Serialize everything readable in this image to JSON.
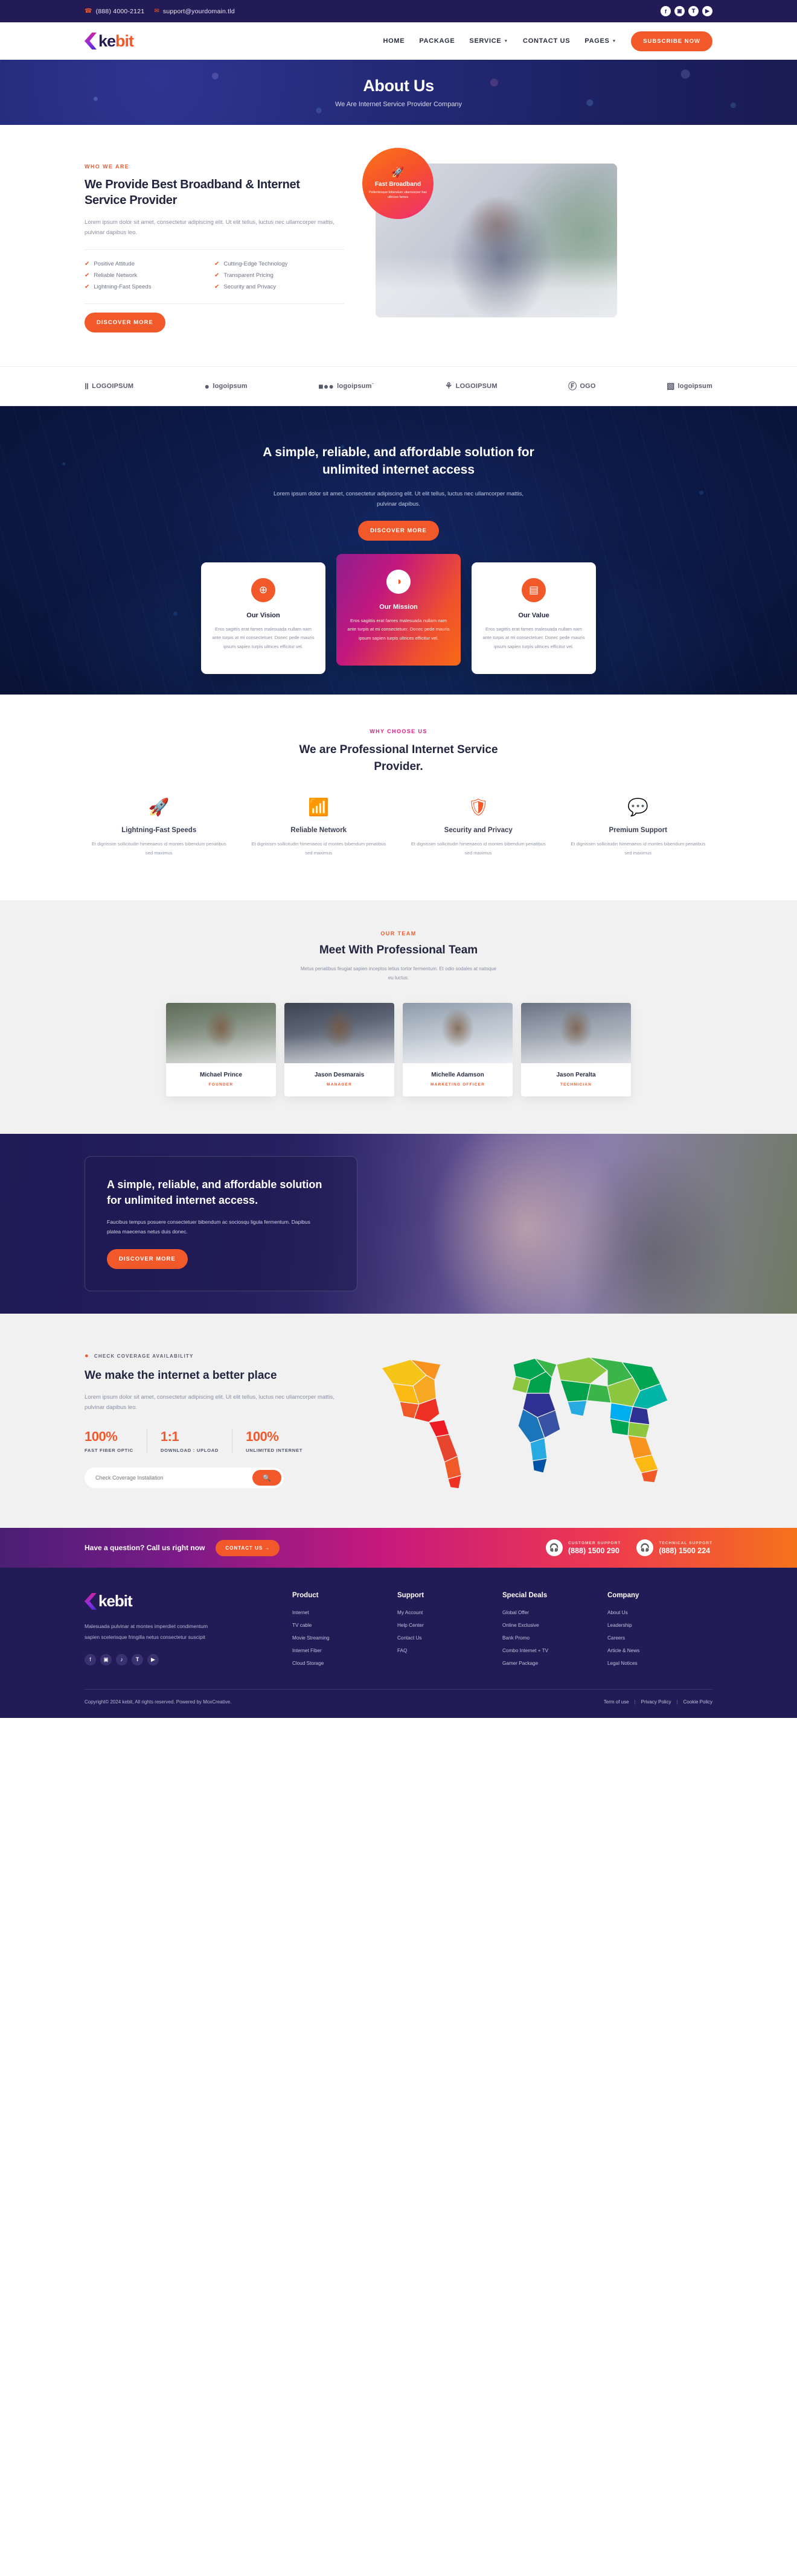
{
  "topbar": {
    "phone": "(888) 4000-2121",
    "email": "support@yourdomain.tld",
    "phone_icon": "phone-icon",
    "email_icon": "envelope-icon",
    "social": [
      {
        "name": "facebook",
        "glyph": "f"
      },
      {
        "name": "instagram",
        "glyph": "▣"
      },
      {
        "name": "twitter",
        "glyph": "𝐓"
      },
      {
        "name": "youtube",
        "glyph": "▶"
      }
    ]
  },
  "nav": {
    "logo_main": "ke",
    "logo_accent": "bit",
    "items": [
      {
        "label": "Home",
        "has_caret": false
      },
      {
        "label": "Package",
        "has_caret": false
      },
      {
        "label": "Service",
        "has_caret": true
      },
      {
        "label": "Contact Us",
        "has_caret": false
      },
      {
        "label": "Pages",
        "has_caret": true
      }
    ],
    "cta": "Subscribe Now"
  },
  "hero": {
    "title": "About Us",
    "subtitle": "We Are Internet Service Provider Company"
  },
  "about": {
    "eyebrow": "WHO WE ARE",
    "title": "We Provide Best Broadband & Internet Service Provider",
    "paragraph": "Lorem ipsum dolor sit amet, consectetur adipiscing elit. Ut elit tellus, luctus nec ullamcorper mattis, pulvinar dapibus leo.",
    "ticks": [
      "Positive Attitude",
      "Cutting-Edge Technology",
      "Reliable Network",
      "Transparent Pricing",
      "Lightning-Fast Speeds",
      "Security and Privacy"
    ],
    "cta": "Discover More",
    "badge": {
      "icon": "rocket-icon",
      "title": "Fast Broadband",
      "text": "Pellentesque bibendum ullamcorper hac ultricies fames"
    }
  },
  "logos": [
    {
      "name": "logoipsum-1",
      "glyph": "‖",
      "text": "LOGOIPSUM"
    },
    {
      "name": "logoipsum-2",
      "glyph": "●",
      "text": "logoipsum"
    },
    {
      "name": "logoipsum-3",
      "glyph": "■●●",
      "text": "logoipsum˙"
    },
    {
      "name": "logoipsum-4",
      "glyph": "⚘",
      "text": "LOGOIPSUM"
    },
    {
      "name": "logoipsum-5",
      "glyph": "Ⓕ",
      "text": "OGO"
    },
    {
      "name": "logoipsum-6",
      "glyph": "▧",
      "text": "logoipsum"
    }
  ],
  "darkcta": {
    "title": "A simple, reliable, and affordable solution for unlimited internet access",
    "paragraph": "Lorem ipsum dolor sit amet, consectetur adipiscing elit. Ut elit tellus, luctus nec ullamcorper mattis, pulvinar dapibus.",
    "cta": "Discover More",
    "cards": [
      {
        "icon": "globe-icon",
        "glyph": "⊕",
        "title": "Our Vision",
        "text": "Eros sagittis erat fames malesuada nullam nam ante turpis at mi consectetuer. Donec pede mauris ipsum sapien turpis ultrices efficitur vel."
      },
      {
        "icon": "wifi-icon",
        "glyph": "◑",
        "title": "Our Mission",
        "text": "Eros sagittis erat fames malesuada nullam nam ante turpis at mi consectetuer. Donec pede mauris ipsum sapien turpis ultrices efficitur vel."
      },
      {
        "icon": "devices-icon",
        "glyph": "▤",
        "title": "Our Value",
        "text": "Eros sagittis erat fames malesuada nullam nam ante turpis at mi consectetuer. Donec pede mauris ipsum sapien turpis ultrices efficitur vel."
      }
    ]
  },
  "why": {
    "eyebrow": "WHY CHOOSE US",
    "title": "We are Professional Internet Service Provider.",
    "features": [
      {
        "icon": "rocket-icon",
        "glyph": "🚀",
        "title": "Lightning-Fast Speeds",
        "text": "Et dignissim sollicitudin himenaeos id montes bibendum penatibus sed maximus"
      },
      {
        "icon": "wifi-icon",
        "glyph": "📶",
        "title": "Reliable Network",
        "text": "Et dignissim sollicitudin himenaeos id montes bibendum penatibus sed maximus"
      },
      {
        "icon": "shield-icon",
        "glyph": "🛡",
        "title": "Security and Privacy",
        "text": "Et dignissim sollicitudin himenaeos id montes bibendum penatibus sed maximus"
      },
      {
        "icon": "support-icon",
        "glyph": "💬",
        "title": "Premium Support",
        "text": "Et dignissim sollicitudin himenaeos id montes bibendum penatibus sed maximus"
      }
    ]
  },
  "team": {
    "eyebrow": "OUR TEAM",
    "title": "Meet With Professional Team",
    "subtitle": "Metus penatibus feugiat sapien inceptos letius tortor fermentum. Et odio sodales at natoque eu luctus.",
    "members": [
      {
        "name": "Michael Prince",
        "role": "Founder"
      },
      {
        "name": "Jason Desmarais",
        "role": "Manager"
      },
      {
        "name": "Michelle Adamson",
        "role": "Marketing Officer"
      },
      {
        "name": "Jason Peralta",
        "role": "Technician"
      }
    ]
  },
  "banner": {
    "title": "A simple, reliable, and affordable solution for unlimited internet access.",
    "paragraph": "Faucibus tempus posuere consectetuer bibendum ac sociosqu ligula fermentum. Dapibus platea maecenas netus duis donec.",
    "cta": "Discover More"
  },
  "coverage": {
    "eyebrow": "CHECK COVERAGE AVAILABILITY",
    "eyebrow_icon": "location-pin-icon",
    "title": "We make the internet a better place",
    "paragraph": "Lorem ipsum dolor sit amet, consectetur adipiscing elit. Ut elit tellus, luctus nec ullamcorper mattis, pulvinar dapibus leo.",
    "stats": [
      {
        "value": "100%",
        "label": "Fast Fiber Optic"
      },
      {
        "value": "1:1",
        "label": "Download : Upload"
      },
      {
        "value": "100%",
        "label": "Unlimited Internet"
      }
    ],
    "search_placeholder": "Check Coverage Installation",
    "search_value": "",
    "search_icon": "search-icon"
  },
  "strip": {
    "question": "Have a question? Call us right now",
    "cta": "Contact Us  →",
    "supports": [
      {
        "icon": "headset-icon",
        "label": "Customer Support",
        "number": "(888) 1500 290"
      },
      {
        "icon": "headset-icon",
        "label": "Technical Support",
        "number": "(888) 1500 224"
      }
    ]
  },
  "footer": {
    "logo_main": "ke",
    "logo_accent": "bit",
    "about": "Malesuada pulvinar at montes imperdiet condimentum sapien scelerisque fringilla netus consectetur suscipit",
    "social": [
      {
        "name": "facebook",
        "glyph": "f"
      },
      {
        "name": "instagram",
        "glyph": "▣"
      },
      {
        "name": "tiktok",
        "glyph": "♪"
      },
      {
        "name": "twitter",
        "glyph": "𝐓"
      },
      {
        "name": "youtube",
        "glyph": "▶"
      }
    ],
    "columns": [
      {
        "title": "Product",
        "links": [
          "Internet",
          "TV cable",
          "Movie Streaming",
          "Internet Fiber",
          "Cloud Storage"
        ]
      },
      {
        "title": "Support",
        "links": [
          "My Account",
          "Help Center",
          "Contact Us",
          "FAQ"
        ]
      },
      {
        "title": "Special Deals",
        "links": [
          "Global Offer",
          "Online Exclusive",
          "Bank Promo",
          "Combo Internet + TV",
          "Gamer Package"
        ]
      },
      {
        "title": "Company",
        "links": [
          "About Us",
          "Leadership",
          "Careers",
          "Article & News",
          "Legal Notices"
        ]
      }
    ],
    "copyright": "Copyright© 2024 kebit, All rights reserved. Powered by MoxCreative.",
    "legal": [
      "Term of use",
      "Privacy Policy",
      "Cookie Policy"
    ]
  },
  "colors": {
    "orange": "#f1592a",
    "navy": "#231b56",
    "pink": "#e0218a",
    "dark_blue": "#0d1a47"
  }
}
